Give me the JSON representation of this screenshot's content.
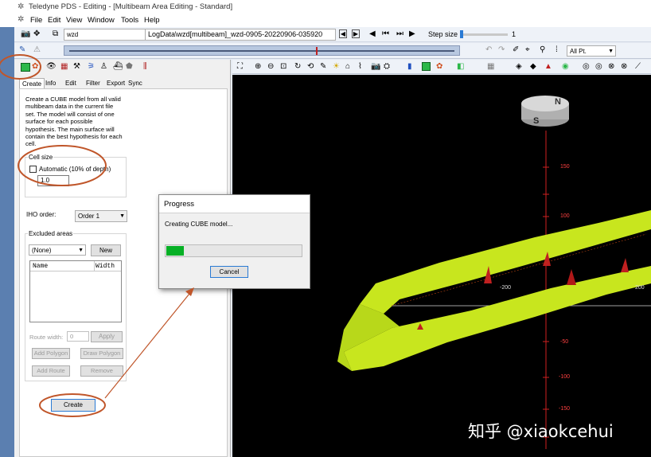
{
  "window": {
    "title": "Teledyne PDS - Editing - [Multibeam Area Editing - Standard]",
    "menu": [
      "File",
      "Edit",
      "View",
      "Window",
      "Tools",
      "Help"
    ]
  },
  "toolbar": {
    "vessel": "wzd",
    "logfile": "LogData\\wzd[multibeam]_wzd-0905-20220906-035920",
    "step_label": "Step size",
    "step_value": "1",
    "points_filter": "All Pt."
  },
  "panel": {
    "tabs": [
      "Create",
      "Info",
      "Edit",
      "Filter",
      "Export",
      "Sync"
    ],
    "active_tab": "Create",
    "description": "Create a CUBE model from all valid multibeam data in the current file set. The model will consist of one surface for each possible hypothesis. The main surface will contain the best hypothesis for each cell.",
    "cell_size_title": "Cell size",
    "automatic_label": "Automatic (10% of depth)",
    "automatic_checked": false,
    "cell_size_value": "1.0",
    "iho_label": "IHO order:",
    "iho_value": "Order 1",
    "excluded_title": "Excluded areas",
    "excluded_value": "(None)",
    "new_button": "New",
    "columns": [
      "Name",
      "Width"
    ],
    "route_width_label": "Route width:",
    "route_width_value": "0",
    "apply_button": "Apply",
    "add_polygon": "Add Polygon",
    "draw_polygon": "Draw Polygon",
    "add_route": "Add Route",
    "remove": "Remove",
    "create_button": "Create"
  },
  "dialog": {
    "title": "Progress",
    "message": "Creating CUBE model...",
    "progress": 0.13,
    "cancel": "Cancel"
  },
  "view3d": {
    "compass": [
      "N",
      "S"
    ],
    "axis_vertical": [
      "150",
      "100",
      "-50",
      "-100",
      "-150"
    ],
    "axis_horizontal": [
      "-200",
      "200"
    ]
  },
  "watermark": "知乎 @xiaokcehui",
  "colors": {
    "surface": "#c8e61e",
    "axis": "#e02020",
    "highlight_ring": "#c0562a"
  }
}
